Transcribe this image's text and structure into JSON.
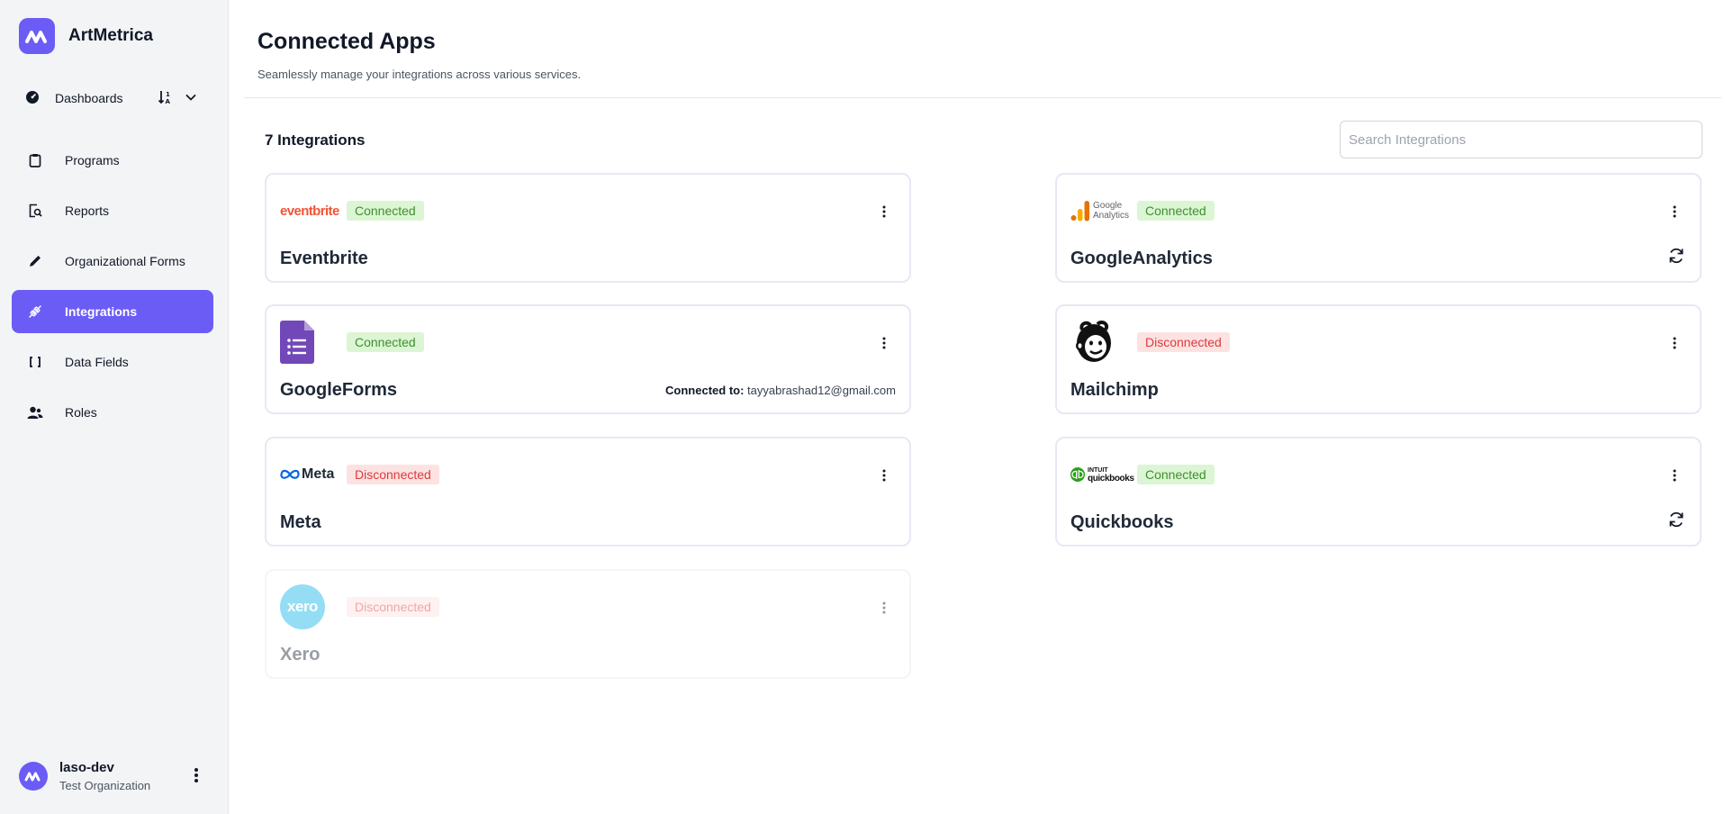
{
  "app": {
    "name": "ArtMetrica"
  },
  "sidebar": {
    "dashboards_label": "Dashboards",
    "items": [
      {
        "label": "Programs",
        "icon": "clipboard-icon"
      },
      {
        "label": "Reports",
        "icon": "report-search-icon"
      },
      {
        "label": "Organizational Forms",
        "icon": "pencil-icon"
      },
      {
        "label": "Integrations",
        "icon": "plug-icon",
        "active": true
      },
      {
        "label": "Data Fields",
        "icon": "brackets-icon"
      },
      {
        "label": "Roles",
        "icon": "users-icon"
      }
    ],
    "user": {
      "name": "laso-dev",
      "org": "Test Organization"
    }
  },
  "header": {
    "title": "Connected Apps",
    "subtitle": "Seamlessly manage your integrations across various services."
  },
  "integrations": {
    "count_label": "7 Integrations",
    "search_placeholder": "Search Integrations",
    "cards": [
      {
        "name": "Eventbrite",
        "status": "Connected",
        "logo_text": "eventbrite"
      },
      {
        "name": "GoogleAnalytics",
        "status": "Connected",
        "logo_text_1": "Google",
        "logo_text_2": "Analytics"
      },
      {
        "name": "GoogleForms",
        "status": "Connected",
        "connected_to_label": "Connected to:",
        "connected_to_value": "tayyabrashad12@gmail.com"
      },
      {
        "name": "Mailchimp",
        "status": "Disconnected"
      },
      {
        "name": "Meta",
        "status": "Disconnected",
        "logo_text": "Meta"
      },
      {
        "name": "Quickbooks",
        "status": "Connected",
        "logo_text_1": "INTUIT",
        "logo_text_2": "quickbooks"
      },
      {
        "name": "Xero",
        "status": "Disconnected",
        "logo_text": "xero"
      }
    ]
  },
  "colors": {
    "accent": "#6b5cf6",
    "connected_bg": "#dcf5d4",
    "connected_text": "#3f8f2e",
    "disconnected_bg": "#fde2e2",
    "disconnected_text": "#dc3b3b"
  }
}
